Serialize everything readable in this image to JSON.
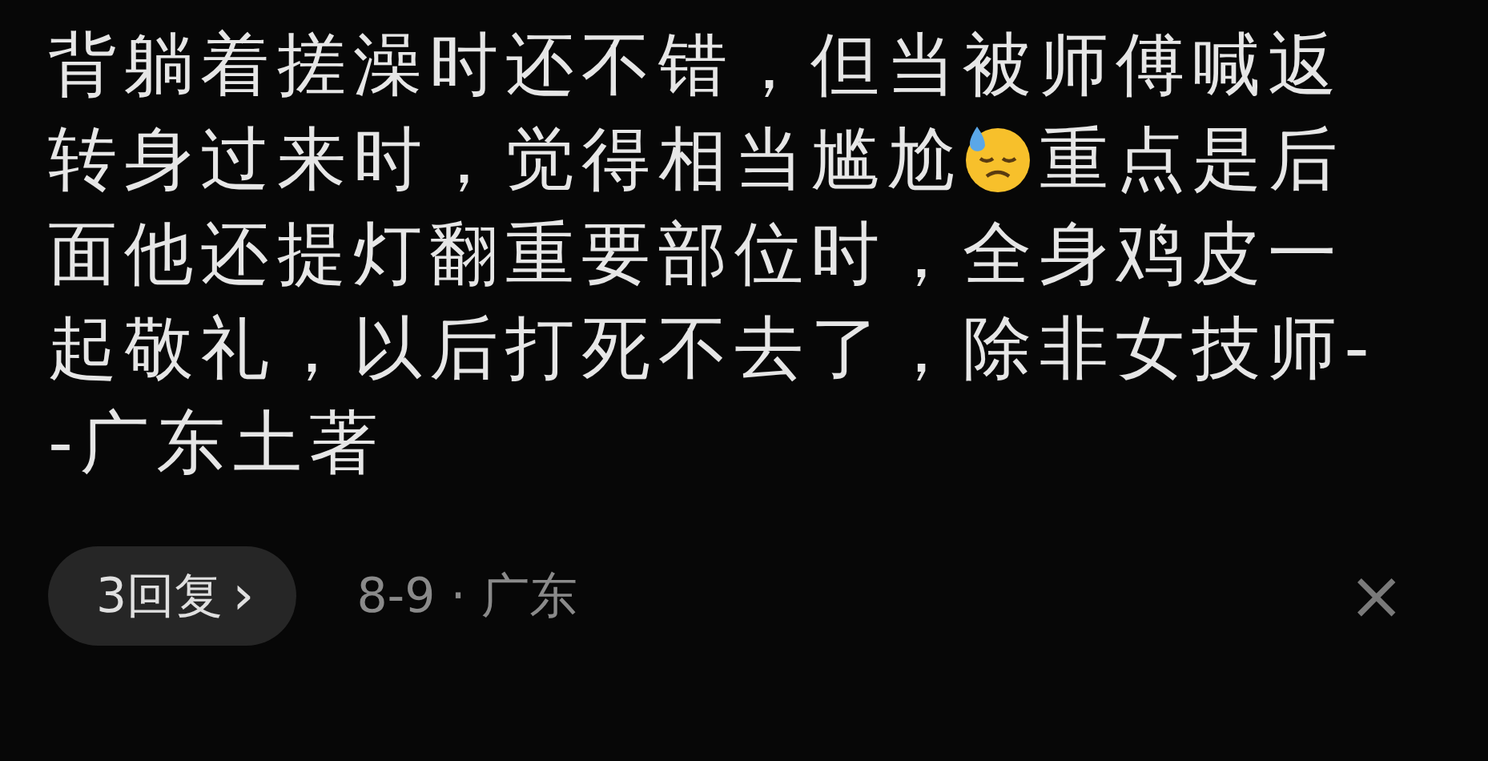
{
  "comment": {
    "segments": [
      {
        "kind": "text",
        "text": "背躺着搓澡时还不错，但当被师傅喊返转身过来时，觉得相当尴尬"
      },
      {
        "kind": "emoji"
      },
      {
        "kind": "text",
        "text": "重点是后面他还提灯翻重要部位时，全身鸡皮一起敬礼，以后打死不去了，除非女技师--广东土著"
      }
    ]
  },
  "replies": {
    "label": "3回复",
    "chevron": "›"
  },
  "meta": "8-9 · 广东",
  "close": "×"
}
